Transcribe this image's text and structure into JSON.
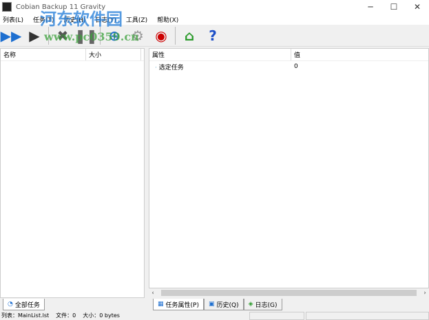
{
  "window": {
    "title": "Cobian Backup 11 Gravity"
  },
  "menu": [
    "列表(L)",
    "任务(T)",
    "历史(H)",
    "日志(Y)",
    "工具(Z)",
    "帮助(X)"
  ],
  "toolbar": [
    {
      "icon": "run-all-icon",
      "glyph": "▶▶",
      "color": "#1e6fd0"
    },
    {
      "icon": "run-icon",
      "glyph": "▶",
      "color": "#333"
    },
    {
      "icon": "cancel-icon",
      "glyph": "✖",
      "color": "#555"
    },
    {
      "icon": "pause-icon",
      "glyph": "❚❚",
      "color": "#666"
    },
    {
      "icon": "add-task-icon",
      "glyph": "⊕",
      "color": "#1e6fd0"
    },
    {
      "icon": "settings-gear-icon",
      "glyph": "⚙",
      "color": "#999"
    },
    {
      "icon": "antenna-icon",
      "glyph": "◉",
      "color": "#c00"
    },
    {
      "icon": "home-icon",
      "glyph": "⌂",
      "color": "#2a9a2a"
    },
    {
      "icon": "help-icon",
      "glyph": "?",
      "color": "#1e50c8"
    }
  ],
  "left": {
    "columns": [
      "名称",
      "大小"
    ],
    "tab": "全部任务"
  },
  "right": {
    "columns": [
      "属性",
      "值"
    ],
    "rows": [
      {
        "name": "选定任务",
        "value": "0"
      }
    ],
    "tabs": [
      "任务属性(P)",
      "历史(Q)",
      "日志(G)"
    ]
  },
  "status": {
    "list": "列表：MainList.lst",
    "files": "文件：0",
    "size": "大小：0 bytes"
  },
  "watermark": {
    "cn": "河东软件园",
    "url": "www.pc0359.cn"
  }
}
